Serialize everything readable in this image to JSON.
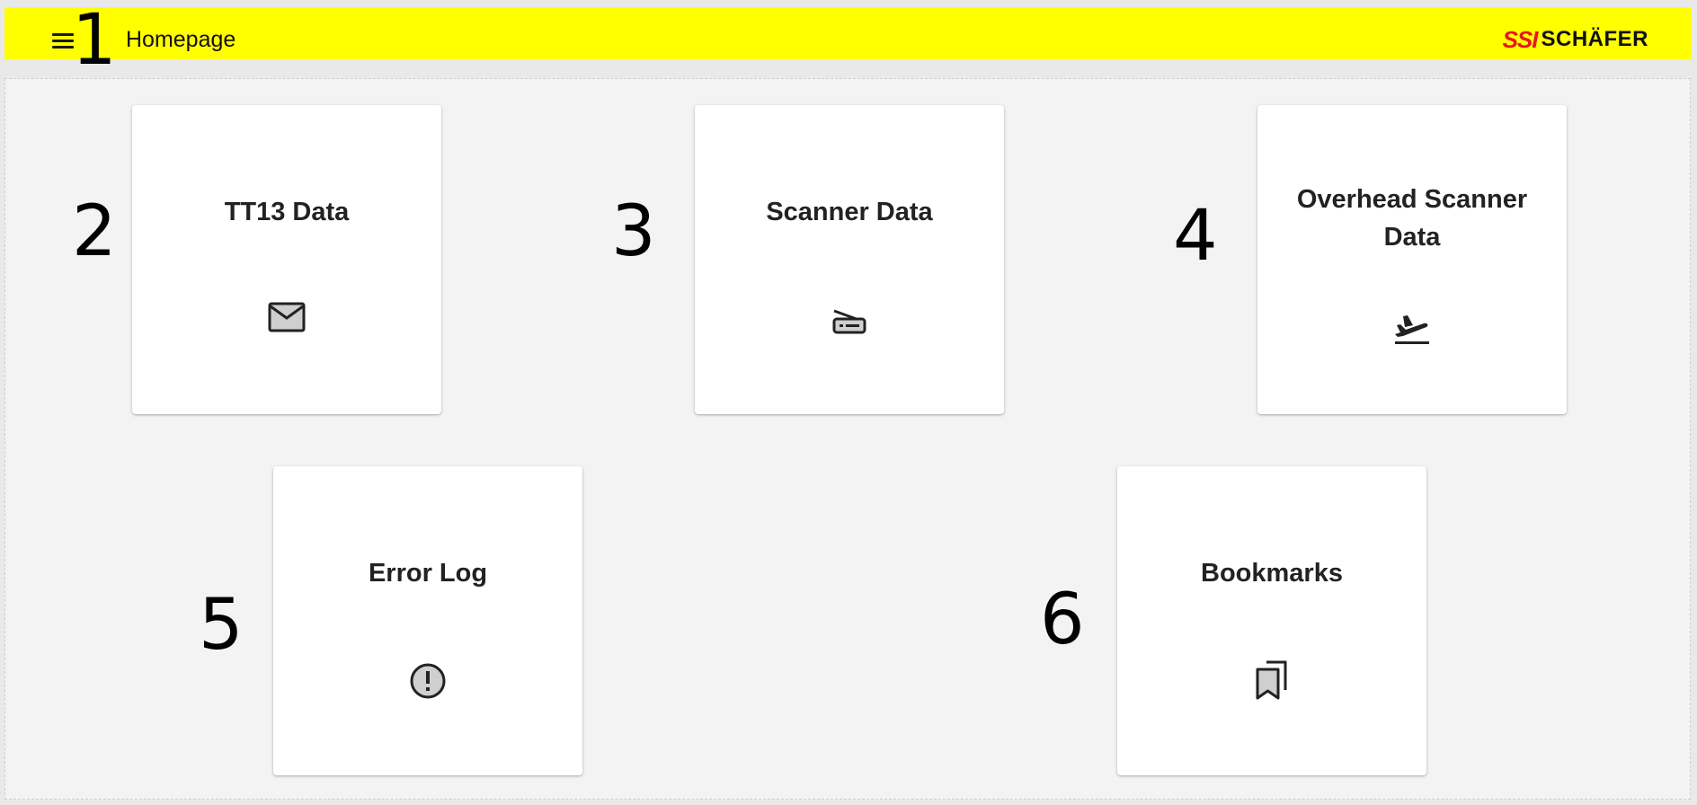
{
  "header": {
    "title": "Homepage",
    "menu_icon": "hamburger-menu-icon",
    "logo": {
      "mark": "SSI",
      "name": "SCHÄFER",
      "mark_color": "#e8161b"
    },
    "background": "#ffff00"
  },
  "markers": [
    "1",
    "2",
    "3",
    "4",
    "5",
    "6"
  ],
  "cards": [
    {
      "title": "TT13 Data",
      "icon": "mail-icon"
    },
    {
      "title": "Scanner Data",
      "icon": "scanner-icon"
    },
    {
      "title": "Overhead Scanner Data",
      "icon": "flight-takeoff-icon"
    },
    {
      "title": "Error Log",
      "icon": "error-icon"
    },
    {
      "title": "Bookmarks",
      "icon": "bookmarks-icon"
    }
  ]
}
